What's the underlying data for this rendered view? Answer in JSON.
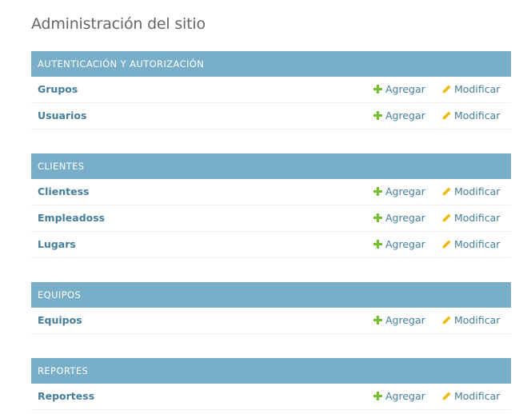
{
  "page_title": "Administración del sitio",
  "colors": {
    "header_bg": "#79aec8",
    "link": "#447e9b",
    "add_icon": "#70bf2b",
    "change_icon": "#efb80b"
  },
  "icons": {
    "add": "plus-icon",
    "change": "pencil-icon"
  },
  "modules": [
    {
      "name": "AUTENTICACIÓN Y AUTORIZACIÓN",
      "models": [
        {
          "name": "Grupos",
          "add_label": "Agregar",
          "change_label": "Modificar"
        },
        {
          "name": "Usuarios",
          "add_label": "Agregar",
          "change_label": "Modificar"
        }
      ]
    },
    {
      "name": "CLIENTES",
      "models": [
        {
          "name": "Clientess",
          "add_label": "Agregar",
          "change_label": "Modificar"
        },
        {
          "name": "Empleadoss",
          "add_label": "Agregar",
          "change_label": "Modificar"
        },
        {
          "name": "Lugars",
          "add_label": "Agregar",
          "change_label": "Modificar"
        }
      ]
    },
    {
      "name": "EQUIPOS",
      "models": [
        {
          "name": "Equipos",
          "add_label": "Agregar",
          "change_label": "Modificar"
        }
      ]
    },
    {
      "name": "REPORTES",
      "models": [
        {
          "name": "Reportess",
          "add_label": "Agregar",
          "change_label": "Modificar"
        }
      ]
    }
  ]
}
